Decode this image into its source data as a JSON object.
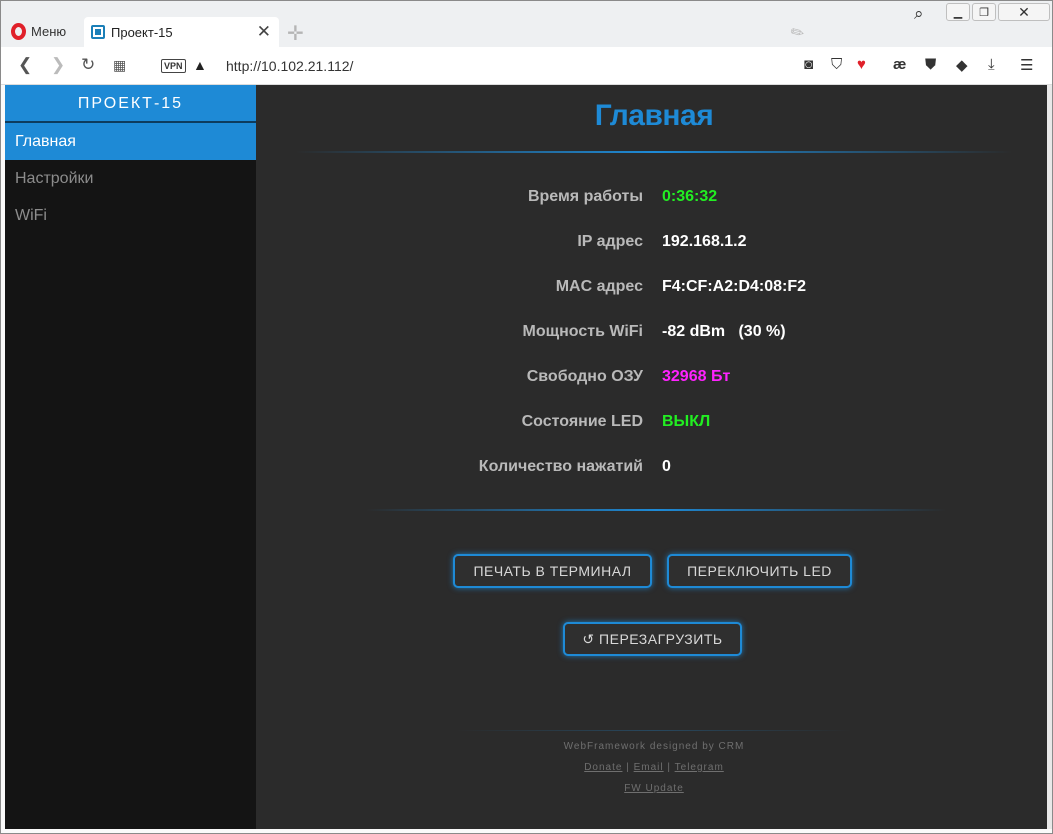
{
  "browser": {
    "menu_label": "Меню",
    "tab_title": "Проект-15",
    "url": "http://10.102.21.112/",
    "vpn_label": "VPN"
  },
  "sidebar": {
    "brand": "ПРОЕКТ-15",
    "items": [
      {
        "label": "Главная",
        "active": true
      },
      {
        "label": "Настройки",
        "active": false
      },
      {
        "label": "WiFi",
        "active": false
      }
    ]
  },
  "main": {
    "title": "Главная",
    "rows": [
      {
        "label": "Время работы",
        "value": "0:36:32",
        "color": "#22ee22"
      },
      {
        "label": "IP адрес",
        "value": "192.168.1.2",
        "color": "#ffffff"
      },
      {
        "label": "MAC адрес",
        "value": "F4:CF:A2:D4:08:F2",
        "color": "#ffffff"
      },
      {
        "label": "Мощность WiFi",
        "value": "-82 dBm   (30 %)",
        "color": "#ffffff"
      },
      {
        "label": "Свободно ОЗУ",
        "value": "32968 Бт",
        "color": "#ff22ff"
      },
      {
        "label": "Состояние LED",
        "value": "ВЫКЛ",
        "color": "#22ee22"
      },
      {
        "label": "Количество нажатий",
        "value": "0",
        "color": "#ffffff"
      }
    ],
    "buttons": {
      "print_terminal": "ПЕЧАТЬ В ТЕРМИНАЛ",
      "toggle_led": "ПЕРЕКЛЮЧИТЬ LED",
      "reboot": "↺ ПЕРЕЗАГРУЗИТЬ"
    }
  },
  "footer": {
    "credit": "WebFramework designed by CRM",
    "donate": "Donate",
    "email": "Email",
    "telegram": "Telegram",
    "separator": "|",
    "fw_update": "FW Update"
  },
  "colors": {
    "accent": "#1e8ad6",
    "sidebar_bg": "#141414",
    "page_bg": "#2b2b2b"
  }
}
